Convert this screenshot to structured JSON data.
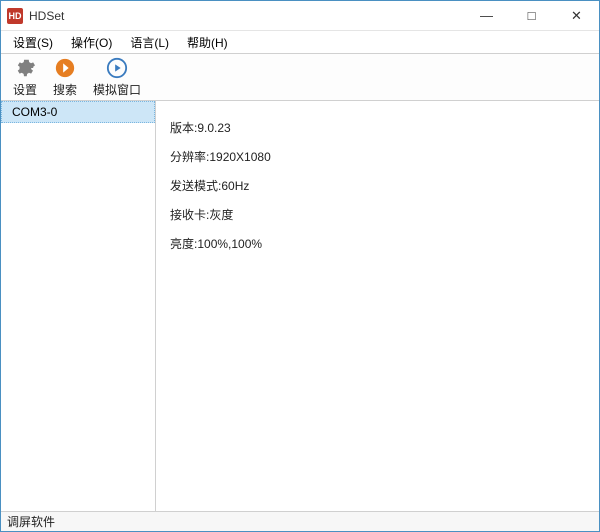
{
  "app": {
    "icon_text": "HD",
    "title": "HDSet"
  },
  "window_controls": {
    "min": "—",
    "max": "□",
    "close": "✕"
  },
  "menu": {
    "settings": "设置(S)",
    "operate": "操作(O)",
    "language": "语言(L)",
    "help": "帮助(H)"
  },
  "toolbar": {
    "settings": "设置",
    "search": "搜索",
    "simwin": "模拟窗口"
  },
  "sidebar": {
    "items": [
      {
        "label": "COM3-0"
      }
    ]
  },
  "detail": {
    "version_label": "版本:",
    "version_value": "9.0.23",
    "resolution_label": "分辨率:",
    "resolution_value": "1920X1080",
    "sendmode_label": "发送模式:",
    "sendmode_value": "60Hz",
    "recvcard_label": "接收卡:",
    "recvcard_value": "灰度",
    "brightness_label": "亮度:",
    "brightness_value": "100%,100%"
  },
  "status": {
    "text": "调屏软件"
  }
}
